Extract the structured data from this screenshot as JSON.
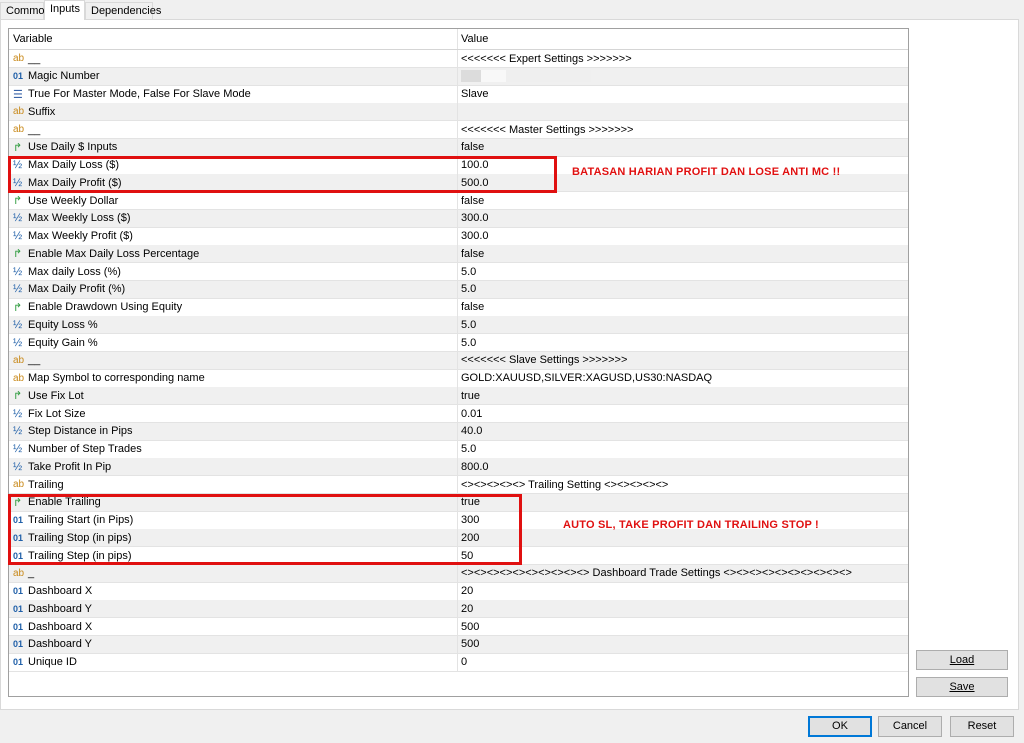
{
  "tabs": [
    "Common",
    "Inputs",
    "Dependencies"
  ],
  "columns": {
    "variable": "Variable",
    "value": "Value"
  },
  "rows": [
    {
      "icon": "ab",
      "name": "__",
      "value": "<<<<<<< Expert Settings >>>>>>>"
    },
    {
      "icon": "01",
      "name": "Magic Number",
      "value": ""
    },
    {
      "icon": "enum",
      "name": "True For Master Mode, False For Slave Mode",
      "value": "Slave"
    },
    {
      "icon": "ab",
      "name": "Suffix",
      "value": ""
    },
    {
      "icon": "ab",
      "name": "__",
      "value": "<<<<<<< Master Settings >>>>>>>"
    },
    {
      "icon": "bool",
      "name": "Use Daily $ Inputs",
      "value": "false"
    },
    {
      "icon": "half",
      "name": "Max Daily Loss ($)",
      "value": "100.0"
    },
    {
      "icon": "half",
      "name": "Max Daily Profit ($)",
      "value": "500.0"
    },
    {
      "icon": "bool",
      "name": "Use Weekly Dollar",
      "value": "false"
    },
    {
      "icon": "half",
      "name": "Max Weekly Loss ($)",
      "value": "300.0"
    },
    {
      "icon": "half",
      "name": "Max Weekly Profit ($)",
      "value": "300.0"
    },
    {
      "icon": "bool",
      "name": "Enable Max Daily Loss Percentage",
      "value": "false"
    },
    {
      "icon": "half",
      "name": "Max daily Loss   (%)",
      "value": "5.0"
    },
    {
      "icon": "half",
      "name": "Max Daily Profit (%)",
      "value": "5.0"
    },
    {
      "icon": "bool",
      "name": "Enable Drawdown Using Equity",
      "value": "false"
    },
    {
      "icon": "half",
      "name": "Equity Loss %",
      "value": "5.0"
    },
    {
      "icon": "half",
      "name": "Equity Gain %",
      "value": "5.0"
    },
    {
      "icon": "ab",
      "name": "__",
      "value": "<<<<<<< Slave Settings >>>>>>>"
    },
    {
      "icon": "ab",
      "name": "Map Symbol to corresponding name",
      "value": "GOLD:XAUUSD,SILVER:XAGUSD,US30:NASDAQ"
    },
    {
      "icon": "bool",
      "name": "Use Fix Lot",
      "value": "true"
    },
    {
      "icon": "half",
      "name": "Fix Lot Size",
      "value": "0.01"
    },
    {
      "icon": "half",
      "name": "Step Distance in Pips",
      "value": "40.0"
    },
    {
      "icon": "half",
      "name": "Number of Step Trades",
      "value": "5.0"
    },
    {
      "icon": "half",
      "name": "Take Profit In Pip",
      "value": "800.0"
    },
    {
      "icon": "ab",
      "name": "Trailing",
      "value": "<><><><><> Trailing Setting <><><><><>"
    },
    {
      "icon": "bool",
      "name": "Enable Trailing",
      "value": "true"
    },
    {
      "icon": "01",
      "name": "Trailing Start (in Pips)",
      "value": "300"
    },
    {
      "icon": "01",
      "name": "Trailing Stop (in pips)",
      "value": "200"
    },
    {
      "icon": "01",
      "name": "Trailing Step (in pips)",
      "value": "50"
    },
    {
      "icon": "ab",
      "name": "_",
      "value": "<><><><><><><><><><> Dashboard Trade Settings <><><><><><><><><><>"
    },
    {
      "icon": "01",
      "name": "Dashboard X",
      "value": "20"
    },
    {
      "icon": "01",
      "name": "Dashboard Y",
      "value": "20"
    },
    {
      "icon": "01",
      "name": "Dashboard X",
      "value": "500"
    },
    {
      "icon": "01",
      "name": "Dashboard Y",
      "value": "500"
    },
    {
      "icon": "01",
      "name": "Unique ID",
      "value": "0"
    }
  ],
  "annotations": {
    "daily": "BATASAN HARIAN PROFIT DAN LOSE ANTI MC !!",
    "trailing": "AUTO SL, TAKE PROFIT DAN TRAILING STOP !"
  },
  "side_buttons": {
    "load": "Load",
    "save": "Save"
  },
  "buttons": {
    "ok": "OK",
    "cancel": "Cancel",
    "reset": "Reset"
  },
  "colors": {
    "annotation": "#e01010",
    "default_button_border": "#0078d7"
  }
}
